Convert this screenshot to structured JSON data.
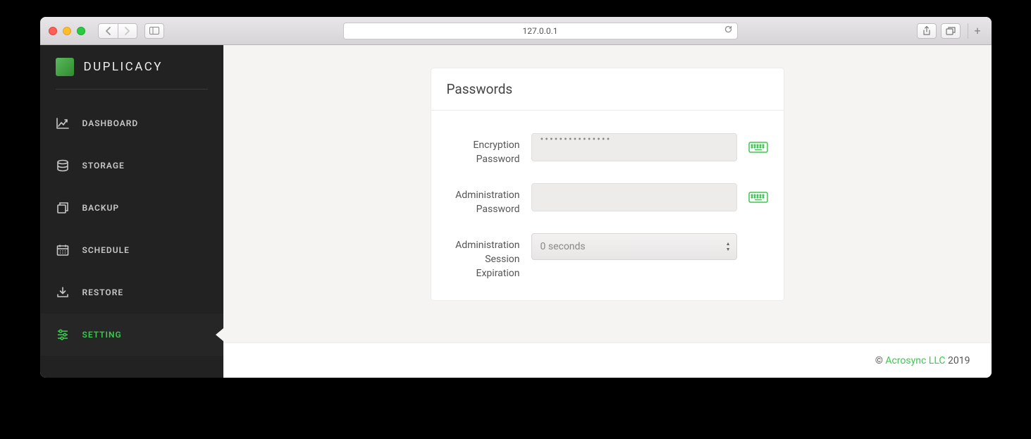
{
  "browser": {
    "address": "127.0.0.1"
  },
  "brand": {
    "name": "DUPLICACY"
  },
  "nav": {
    "items": [
      {
        "label": "DASHBOARD"
      },
      {
        "label": "STORAGE"
      },
      {
        "label": "BACKUP"
      },
      {
        "label": "SCHEDULE"
      },
      {
        "label": "RESTORE"
      },
      {
        "label": "SETTING"
      }
    ]
  },
  "card": {
    "title": "Passwords",
    "fields": {
      "encryption": {
        "label": "Encryption Password",
        "value": "•••••••••••••••"
      },
      "admin": {
        "label": "Administration Password",
        "value": ""
      },
      "session": {
        "label": "Administration Session Expiration",
        "selected": "0 seconds"
      }
    }
  },
  "footer": {
    "copyright": "©",
    "company": "Acrosync LLC",
    "year": "2019"
  }
}
